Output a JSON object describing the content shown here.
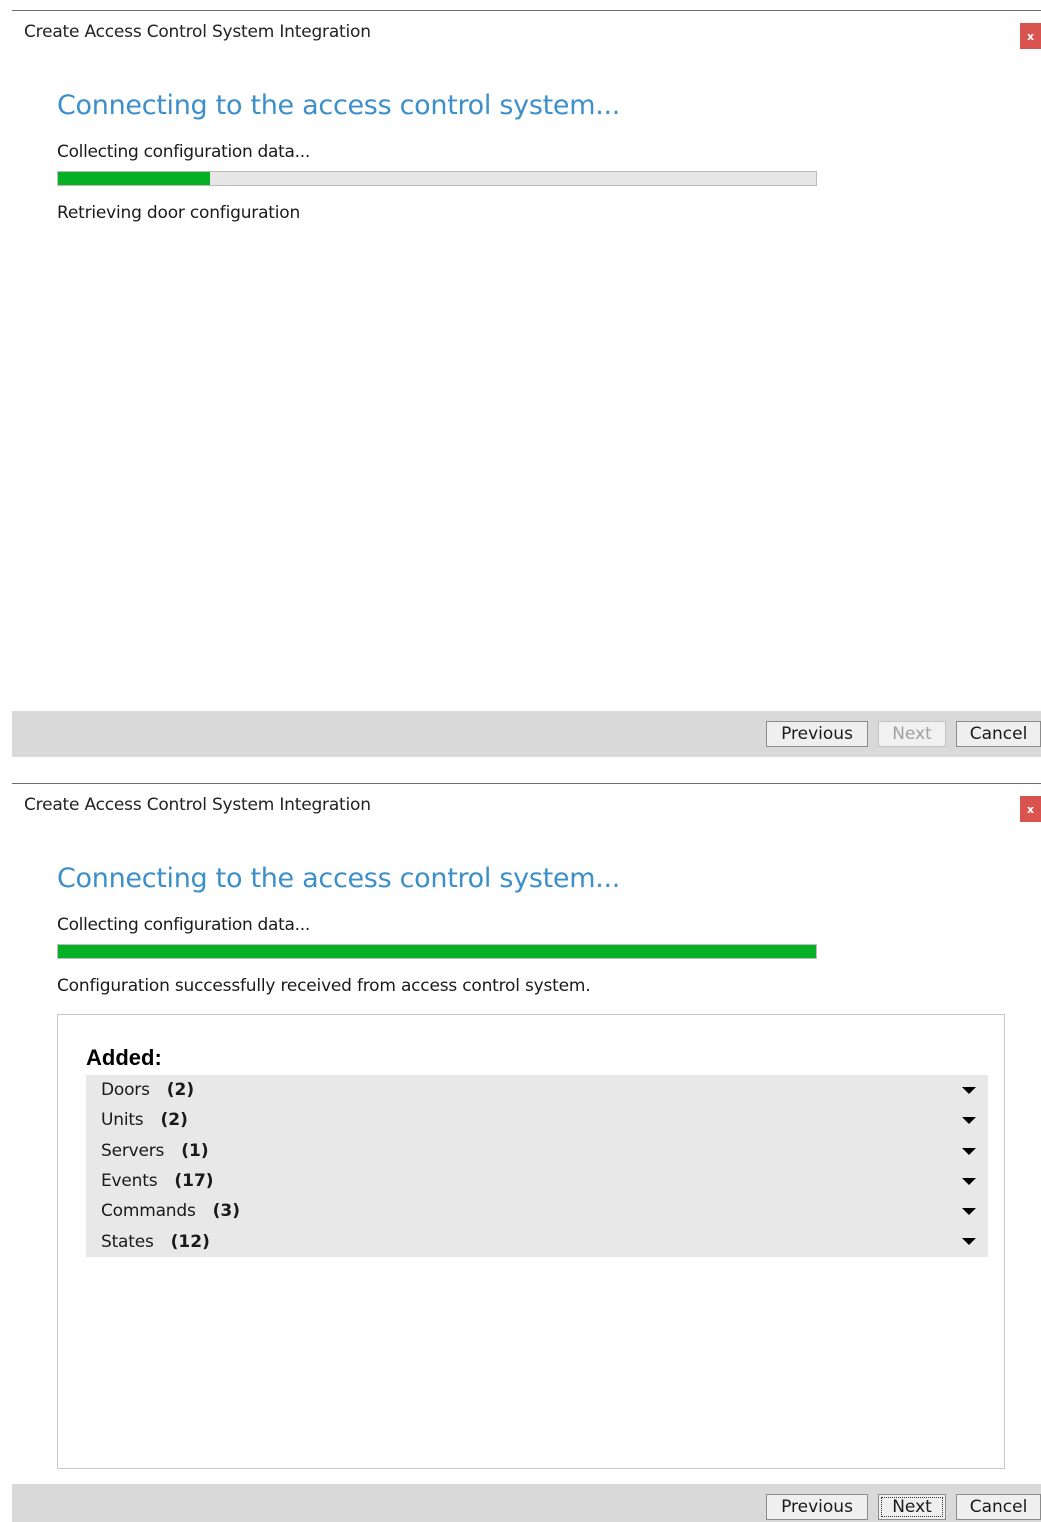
{
  "dialog1": {
    "title": "Create Access Control System Integration",
    "close_label": "x",
    "heading": "Connecting to the access control system...",
    "subheading": "Collecting configuration data...",
    "progress_fraction": 0.2,
    "status": "Retrieving door configuration",
    "buttons": {
      "previous": "Previous",
      "next": "Next",
      "cancel": "Cancel"
    }
  },
  "dialog2": {
    "title": "Create Access Control System Integration",
    "close_label": "x",
    "heading": "Connecting to the access control system...",
    "subheading": "Collecting configuration data...",
    "progress_fraction": 1.0,
    "status": "Configuration successfully received from access control system.",
    "added_heading": "Added:",
    "items": [
      {
        "label": "Doors",
        "count": "(2)"
      },
      {
        "label": "Units",
        "count": "(2)"
      },
      {
        "label": "Servers",
        "count": "(1)"
      },
      {
        "label": "Events",
        "count": "(17)"
      },
      {
        "label": "Commands",
        "count": "(3)"
      },
      {
        "label": "States",
        "count": "(12)"
      }
    ],
    "buttons": {
      "previous": "Previous",
      "next": "Next",
      "cancel": "Cancel"
    }
  },
  "colors": {
    "heading": "#3d8fc9",
    "progress_fill": "#06b025",
    "close_button": "#d9534f"
  }
}
